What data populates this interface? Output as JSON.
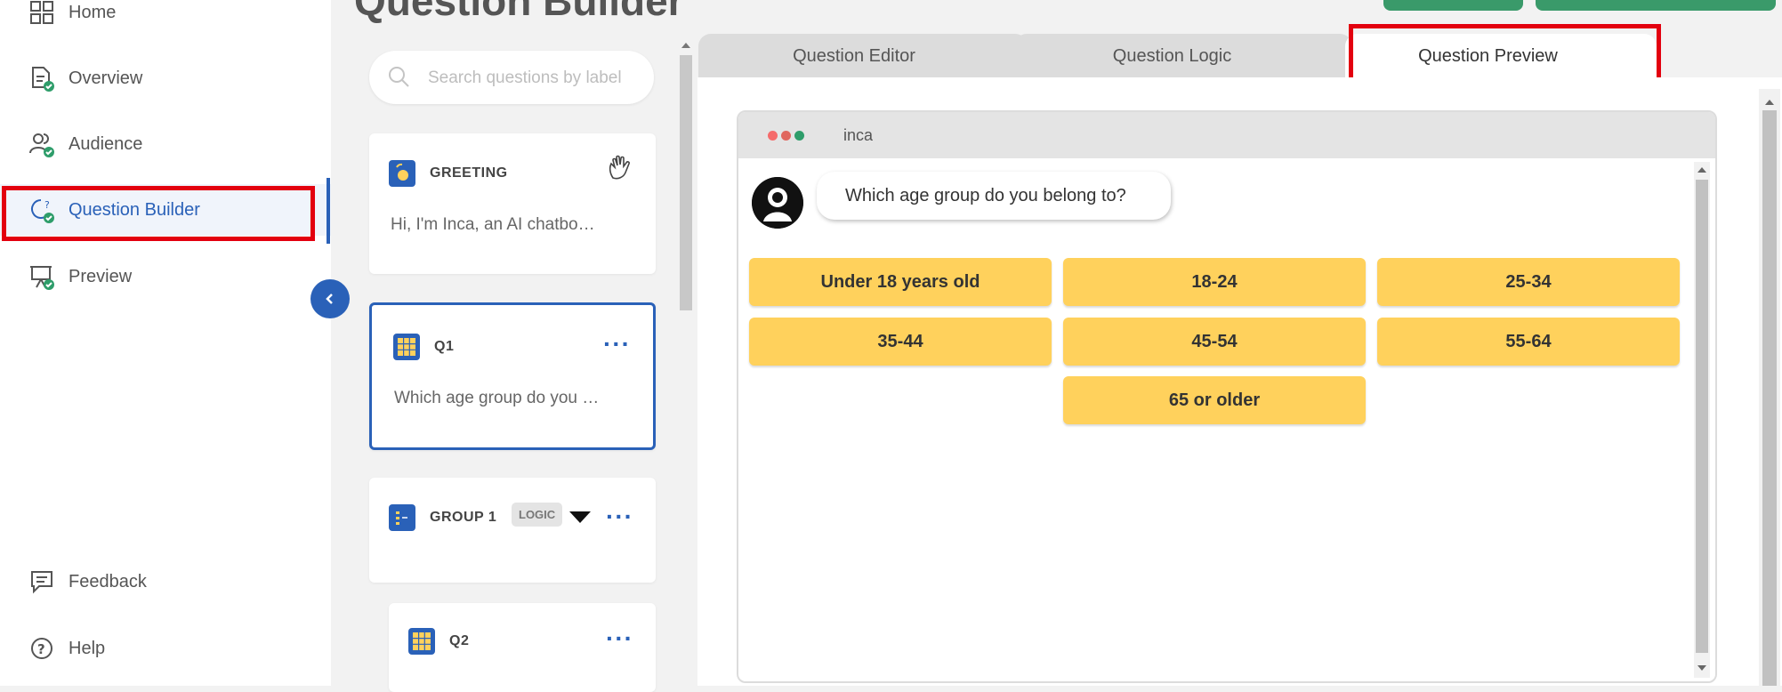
{
  "sidebar": {
    "items": [
      {
        "label": "Home",
        "icon": "grid-icon"
      },
      {
        "label": "Overview",
        "icon": "document-check-icon"
      },
      {
        "label": "Audience",
        "icon": "users-check-icon"
      },
      {
        "label": "Question Builder",
        "icon": "question-bubble-icon"
      },
      {
        "label": "Preview",
        "icon": "presentation-check-icon"
      }
    ],
    "bottom_items": [
      {
        "label": "Feedback",
        "icon": "feedback-icon"
      },
      {
        "label": "Help",
        "icon": "help-icon"
      }
    ],
    "active_index": 3
  },
  "page": {
    "title": "Question Builder"
  },
  "search": {
    "placeholder": "Search questions by label"
  },
  "cards": {
    "greeting": {
      "title": "GREETING",
      "text": "Hi, I'm Inca, an AI chatbo…"
    },
    "q1": {
      "title": "Q1",
      "text": "Which age group do you …"
    },
    "group1": {
      "title": "GROUP 1",
      "badge": "LOGIC"
    },
    "q2": {
      "title": "Q2"
    }
  },
  "tabs": [
    {
      "label": "Question Editor"
    },
    {
      "label": "Question Logic"
    },
    {
      "label": "Question Preview"
    }
  ],
  "active_tab": 2,
  "preview": {
    "window_title": "inca",
    "question": "Which age group do you belong to?",
    "options": [
      "Under 18 years old",
      "18-24",
      "25-34",
      "35-44",
      "45-54",
      "55-64",
      "65 or older"
    ]
  },
  "colors": {
    "accent": "#2a61b8",
    "highlight": "#e3000f",
    "option": "#ffd15c",
    "success": "#2e9d6a"
  }
}
